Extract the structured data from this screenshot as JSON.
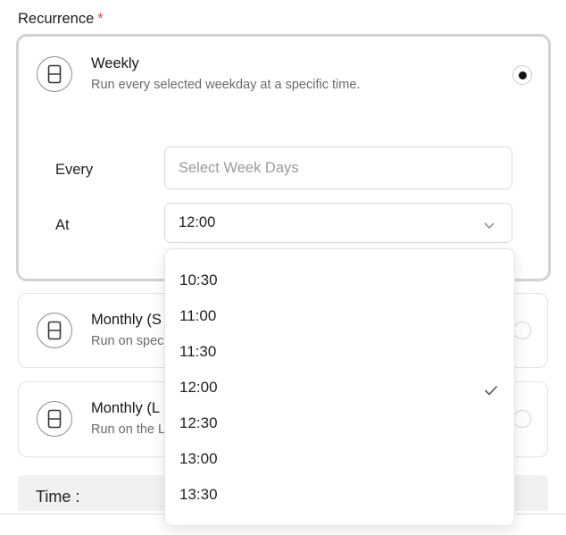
{
  "field": {
    "label": "Recurrence",
    "required_mark": "*"
  },
  "options": [
    {
      "title": "Weekly",
      "description": "Run every selected weekday at a specific time.",
      "selected": true
    },
    {
      "title": "Monthly (S",
      "description": "Run on spec",
      "selected": false
    },
    {
      "title": "Monthly (L",
      "description": "Run on the L",
      "selected": false
    }
  ],
  "weekly": {
    "every_label": "Every",
    "weekdays_placeholder": "Select Week Days",
    "at_label": "At",
    "at_value": "12:00"
  },
  "dropdown": {
    "items": [
      "10:30",
      "11:00",
      "11:30",
      "12:00",
      "12:30",
      "13:00",
      "13:30"
    ],
    "selected": "12:00"
  },
  "time_section": {
    "label": "Time :"
  },
  "icons": {
    "option": "hourglass-icon",
    "select": "chevron-down-icon",
    "checked": "check-icon"
  }
}
